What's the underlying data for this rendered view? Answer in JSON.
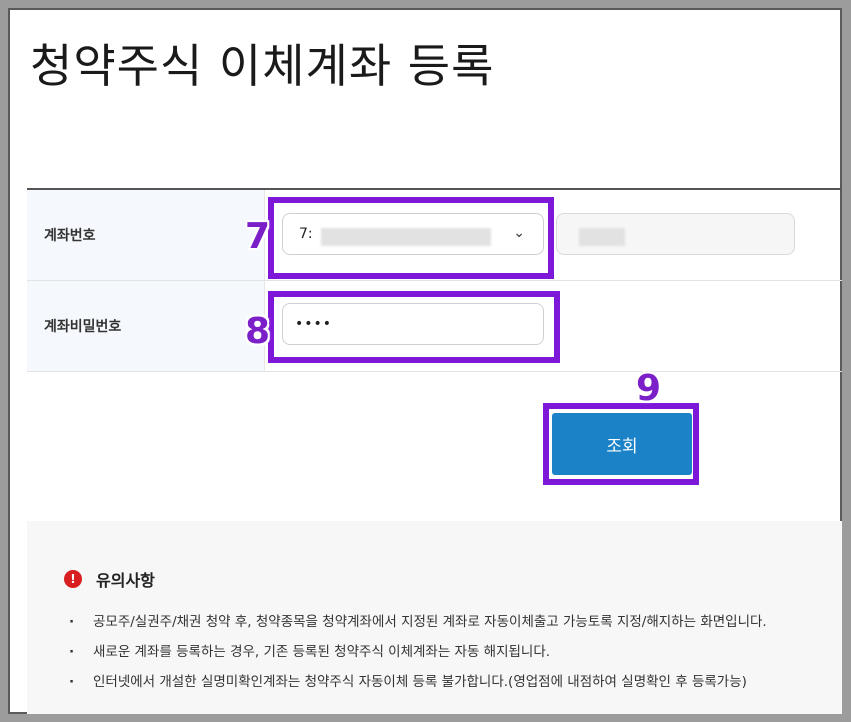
{
  "page_title": "청약주식 이체계좌 등록",
  "form": {
    "account_label": "계좌번호",
    "account_value_prefix": "7:",
    "password_label": "계좌비밀번호",
    "password_value": "••••"
  },
  "markers": {
    "account": "7",
    "password": "8",
    "search": "9"
  },
  "search_button_label": "조회",
  "notice": {
    "title": "유의사항",
    "items": [
      "공모주/실권주/채권 청약 후, 청약종목을 청약계좌에서 지정된 계좌로 자동이체출고 가능토록 지정/해지하는 화면입니다.",
      "새로운 계좌를 등록하는 경우, 기존 등록된 청약주식 이체계좌는 자동 해지됩니다.",
      "인터넷에서 개설한 실명미확인계좌는 청약주식 자동이체 등록 불가합니다.(영업점에 내점하여 실명확인 후 등록가능)"
    ]
  },
  "colors": {
    "highlight": "#7e18d8",
    "button": "#1b82c7",
    "alert": "#d81e1e"
  }
}
